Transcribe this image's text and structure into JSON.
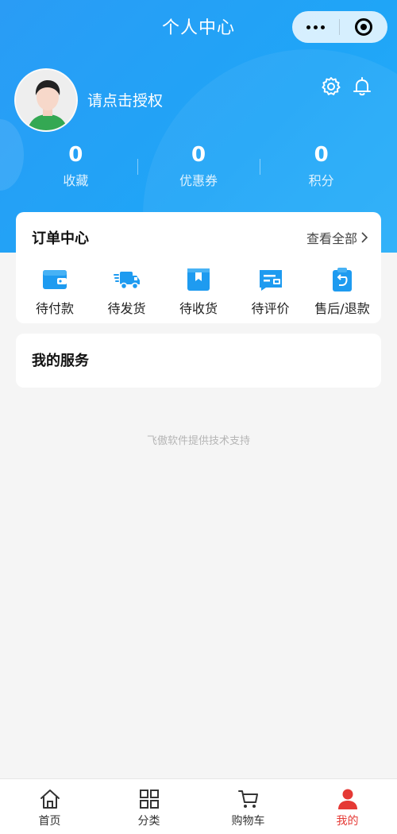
{
  "nav": {
    "title": "个人中心"
  },
  "profile": {
    "login_text": "请点击授权"
  },
  "stats": [
    {
      "value": "0",
      "label": "收藏"
    },
    {
      "value": "0",
      "label": "优惠券"
    },
    {
      "value": "0",
      "label": "积分"
    }
  ],
  "orders": {
    "title": "订单中心",
    "view_all": "查看全部",
    "items": [
      {
        "label": "待付款",
        "icon": "wallet-icon"
      },
      {
        "label": "待发货",
        "icon": "truck-icon"
      },
      {
        "label": "待收货",
        "icon": "package-icon"
      },
      {
        "label": "待评价",
        "icon": "review-icon"
      },
      {
        "label": "售后/退款",
        "icon": "refund-icon"
      }
    ]
  },
  "services": {
    "title": "我的服务"
  },
  "footer_note": "飞傲软件提供技术支持",
  "tabbar": {
    "items": [
      {
        "label": "首页",
        "icon": "home-icon"
      },
      {
        "label": "分类",
        "icon": "grid-icon"
      },
      {
        "label": "购物车",
        "icon": "cart-icon"
      },
      {
        "label": "我的",
        "icon": "user-icon"
      }
    ]
  },
  "colors": {
    "primary": "#1fa5f7",
    "active_tab": "#e53935",
    "icon_blue": "#1e9bf0"
  }
}
